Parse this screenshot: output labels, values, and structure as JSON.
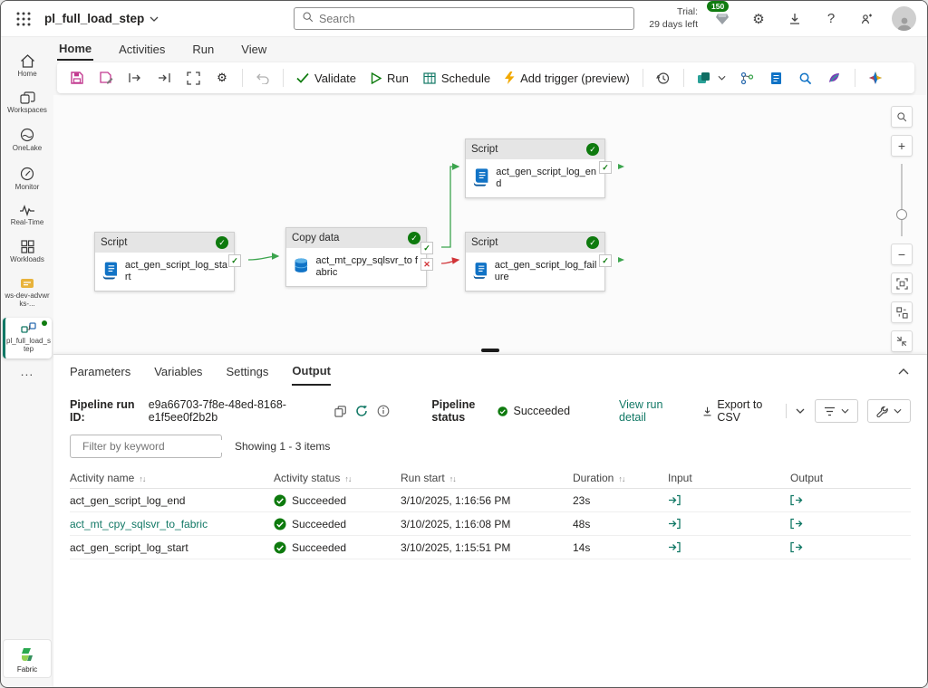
{
  "colors": {
    "accent": "#117865",
    "success": "#107c10",
    "error": "#d13438"
  },
  "topbar": {
    "title": "pl_full_load_step",
    "search_placeholder": "Search",
    "trial_line1": "Trial:",
    "trial_line2": "29 days left",
    "badge_count": "150"
  },
  "ribbon": {
    "tabs": [
      {
        "label": "Home"
      },
      {
        "label": "Activities"
      },
      {
        "label": "Run"
      },
      {
        "label": "View"
      }
    ],
    "active": "Home"
  },
  "toolbar": {
    "validate": "Validate",
    "run": "Run",
    "schedule": "Schedule",
    "add_trigger": "Add trigger (preview)"
  },
  "sidebar": {
    "items": [
      {
        "label": "Home"
      },
      {
        "label": "Workspaces"
      },
      {
        "label": "OneLake"
      },
      {
        "label": "Monitor"
      },
      {
        "label": "Real-Time"
      },
      {
        "label": "Workloads"
      },
      {
        "label": "ws-dev-advwrks-..."
      }
    ],
    "active_item": "pl_full_load_step",
    "more": "...",
    "fabric": "Fabric"
  },
  "canvas": {
    "nodes": [
      {
        "type": "Script",
        "name": "act_gen_script_log_start",
        "status": "Succeeded"
      },
      {
        "type": "Copy data",
        "name": "act_mt_cpy_sqlsvr_to fabric",
        "status": "Succeeded"
      },
      {
        "type": "Script",
        "name": "act_gen_script_log_end",
        "status": "Succeeded"
      },
      {
        "type": "Script",
        "name": "act_gen_script_log_failure",
        "status": "Succeeded"
      }
    ]
  },
  "panel": {
    "tabs": [
      {
        "label": "Parameters"
      },
      {
        "label": "Variables"
      },
      {
        "label": "Settings"
      },
      {
        "label": "Output"
      }
    ],
    "active_tab": "Output",
    "run_id_label": "Pipeline run ID:",
    "run_id": "e9a66703-7f8e-48ed-8168-e1f5ee0f2b2b",
    "status_label": "Pipeline status",
    "status_value": "Succeeded",
    "view_run_detail": "View run detail",
    "export_csv": "Export to CSV",
    "filter_placeholder": "Filter by keyword",
    "showing": "Showing 1 - 3 items",
    "icons": {
      "sort": "↑↓"
    },
    "table": {
      "columns": [
        {
          "label": "Activity name"
        },
        {
          "label": "Activity status"
        },
        {
          "label": "Run start"
        },
        {
          "label": "Duration"
        },
        {
          "label": "Input"
        },
        {
          "label": "Output"
        }
      ],
      "rows": [
        {
          "name": "act_gen_script_log_end",
          "status": "Succeeded",
          "start": "3/10/2025, 1:16:56 PM",
          "duration": "23s"
        },
        {
          "name": "act_mt_cpy_sqlsvr_to_fabric",
          "status": "Succeeded",
          "start": "3/10/2025, 1:16:08 PM",
          "duration": "48s"
        },
        {
          "name": "act_gen_script_log_start",
          "status": "Succeeded",
          "start": "3/10/2025, 1:15:51 PM",
          "duration": "14s"
        }
      ]
    }
  }
}
